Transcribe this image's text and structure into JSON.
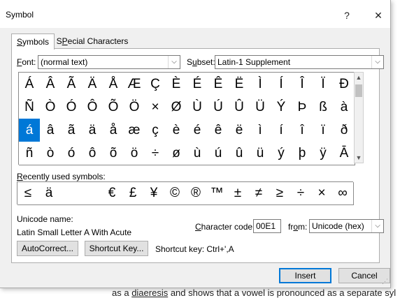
{
  "window": {
    "title": "Symbol",
    "help_glyph": "?",
    "close_glyph": "✕"
  },
  "tabs": [
    {
      "label": "Symbols",
      "mnemonic": "S",
      "rest": "ymbols"
    },
    {
      "label": "Special Characters",
      "mnemonic": "P",
      "before": "S",
      "rest": "ecial Characters"
    }
  ],
  "font": {
    "label_mn": "F",
    "label_rest": "ont:",
    "value": "(normal text)"
  },
  "subset": {
    "label_mn": "u",
    "label_before": "S",
    "label_rest": "bset:",
    "value": "Latin-1 Supplement"
  },
  "symbol_rows": [
    [
      "Á",
      "Â",
      "Ã",
      "Ä",
      "Å",
      "Æ",
      "Ç",
      "È",
      "É",
      "Ê",
      "Ë",
      "Ì",
      "Í",
      "Î",
      "Ï",
      "Ð"
    ],
    [
      "Ñ",
      "Ò",
      "Ó",
      "Ô",
      "Õ",
      "Ö",
      "×",
      "Ø",
      "Ù",
      "Ú",
      "Û",
      "Ü",
      "Ý",
      "Þ",
      "ß",
      "à"
    ],
    [
      "á",
      "â",
      "ã",
      "ä",
      "å",
      "æ",
      "ç",
      "è",
      "é",
      "ê",
      "ë",
      "ì",
      "í",
      "î",
      "ï",
      "ð"
    ],
    [
      "ñ",
      "ò",
      "ó",
      "ô",
      "õ",
      "ö",
      "÷",
      "ø",
      "ù",
      "ú",
      "û",
      "ü",
      "ý",
      "þ",
      "ÿ",
      "Ā"
    ]
  ],
  "selected_symbol": "á",
  "recent": {
    "label_mn": "R",
    "label_rest": "ecently used symbols:",
    "symbols": [
      "≤",
      "ä",
      "",
      "",
      "€",
      "£",
      "¥",
      "©",
      "®",
      "™",
      "±",
      "≠",
      "≥",
      "÷",
      "×",
      "∞"
    ]
  },
  "unicode_name": {
    "label": "Unicode name:",
    "value": "Latin Small Letter A With Acute"
  },
  "character_code": {
    "label_before": "Character code: ",
    "label_mn": "C",
    "label_rest": "haracter code:",
    "value": "00E1"
  },
  "from": {
    "label_before": "fr",
    "label_mn": "o",
    "label_rest": "m:",
    "value": "Unicode (hex)"
  },
  "buttons": {
    "autocorrect": "AutoCorrect...",
    "shortcut_key": "Shortcut Key...",
    "insert": "Insert",
    "cancel": "Cancel"
  },
  "shortcut_text": "Shortcut key: Ctrl+',A",
  "background_doc": {
    "line1_pre": "as a ",
    "line1_link": "diaeresis",
    "line1_post": " and shows that a vowel is pronounced as a separate syl"
  }
}
